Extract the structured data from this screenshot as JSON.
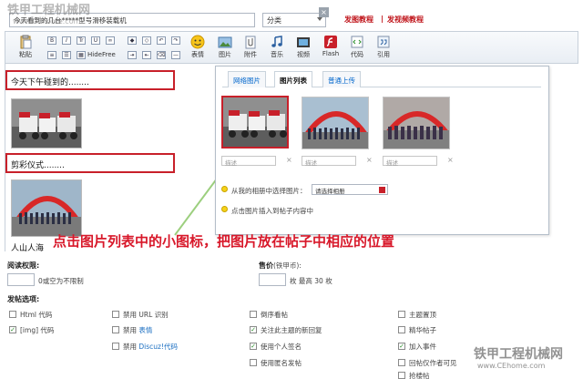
{
  "header": {
    "subject_value": "今天看到的几台*****型号滑移装载机",
    "category_value": "分类",
    "tutorial_pic": "发图教程",
    "tutorial_sep": "|",
    "tutorial_video": "发视频教程"
  },
  "toolbar": {
    "paste": "粘贴",
    "emoticon": "表情",
    "image": "图片",
    "attachment": "附件",
    "music": "音乐",
    "video": "视频",
    "flash": "Flash",
    "code": "代码",
    "quote": "引用",
    "small_b": "B",
    "small_i": "I",
    "small_tt": "Tr",
    "small_hide": "Hide",
    "small_free": "Free"
  },
  "editor": {
    "line1": "今天下午碰到的........",
    "line2": "剪彩仪式........",
    "line3": "人山人海"
  },
  "dialog": {
    "tabs": [
      "网络图片",
      "图片列表",
      "普通上传"
    ],
    "active_tab": 1,
    "close": "×",
    "desc_placeholder": "描述",
    "desc_x": "×",
    "album_label": "从我的相册中选择图片：",
    "album_value": "请选择相册",
    "hint": "点击图片插入到帖子内容中"
  },
  "caption": "点击图片列表中的小图标，把图片放在帖子中相应的位置",
  "form": {
    "read_perm_label": "阅读权限:",
    "read_perm_hint": "0或空为不限制",
    "price_label": "售价",
    "price_unit": "(铁甲币):",
    "price_hint": "枚 最高 30 枚",
    "options_label": "发帖选项:",
    "col1": [
      {
        "text": "Html 代码",
        "checked": false
      },
      {
        "text": "[img] 代码",
        "checked": true
      }
    ],
    "col2": [
      {
        "pre": "禁用",
        "text": "URL 识别",
        "link": false,
        "checked": false
      },
      {
        "pre": "禁用",
        "text": "表情",
        "link": true,
        "checked": false
      },
      {
        "pre": "禁用",
        "text": "Discuz!代码",
        "link": true,
        "checked": false
      }
    ],
    "col3": [
      {
        "text": "倒序看帖",
        "checked": false
      },
      {
        "text": "关注此主题的新回复",
        "checked": true
      },
      {
        "text": "使用个人签名",
        "checked": true
      },
      {
        "text": "使用匿名发帖",
        "checked": false
      }
    ],
    "col4": [
      {
        "text": "主题置顶",
        "checked": false
      },
      {
        "text": "精华帖子",
        "checked": false
      },
      {
        "text": "加入事件",
        "checked": true
      },
      {
        "text": "回帖仅作者可见",
        "checked": false
      },
      {
        "text": "抢楼帖",
        "checked": false
      }
    ]
  },
  "watermark": {
    "top_main": "铁甲工程机械网",
    "top_url": "www.CEhome.com",
    "bottom_main": "铁甲工程机械网",
    "bottom_url": "www.CEhome.com"
  },
  "colors": {
    "accent_red": "#c8202a",
    "link_blue": "#1b6fc2",
    "caption_red": "#d8182a"
  }
}
